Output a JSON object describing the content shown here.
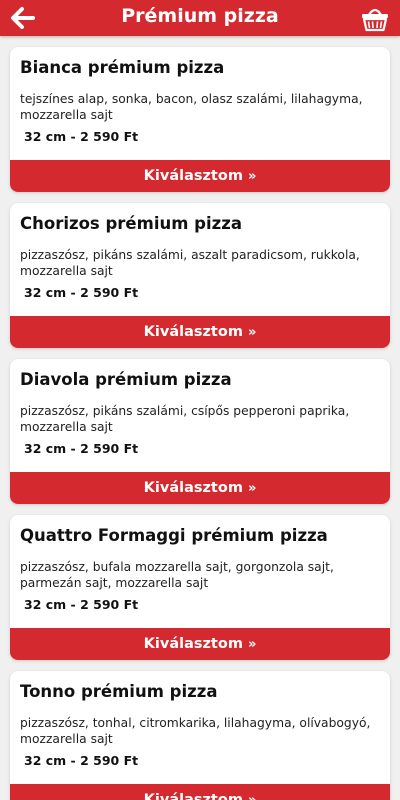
{
  "header": {
    "title": "Prémium pizza",
    "back_icon": "arrow-left-icon",
    "cart_icon": "basket-icon",
    "color": "#d42a2f"
  },
  "products": [
    {
      "name": "Bianca prémium pizza",
      "description": "tejszínes alap, sonka, bacon, olasz szalámi, lilahagyma, mozzarella  sajt",
      "price": "32 cm - 2 590 Ft",
      "button": "Kiválasztom",
      "button_icon": "double-chevron-right-icon"
    },
    {
      "name": "Chorizos prémium pizza",
      "description": "pizzaszósz, pikáns szalámi, aszalt paradicsom, rukkola, mozzarella  sajt",
      "price": "32 cm - 2 590 Ft",
      "button": "Kiválasztom",
      "button_icon": "double-chevron-right-icon"
    },
    {
      "name": "Diavola prémium pizza",
      "description": "pizzaszósz, pikáns szalámi, csípős pepperoni paprika, mozzarella  sajt",
      "price": "32 cm - 2 590 Ft",
      "button": "Kiválasztom",
      "button_icon": "double-chevron-right-icon"
    },
    {
      "name": "Quattro Formaggi prémium pizza",
      "description": "pizzaszósz, bufala mozzarella sajt, gorgonzola sajt, parmezán sajt, mozzarella  sajt",
      "price": "32 cm - 2 590 Ft",
      "button": "Kiválasztom",
      "button_icon": "double-chevron-right-icon"
    },
    {
      "name": "Tonno prémium pizza",
      "description": "pizzaszósz, tonhal, citromkarika, lilahagyma, olívabogyó, mozzarella  sajt",
      "price": "32 cm - 2 590 Ft",
      "button": "Kiválasztom",
      "button_icon": "double-chevron-right-icon"
    }
  ]
}
